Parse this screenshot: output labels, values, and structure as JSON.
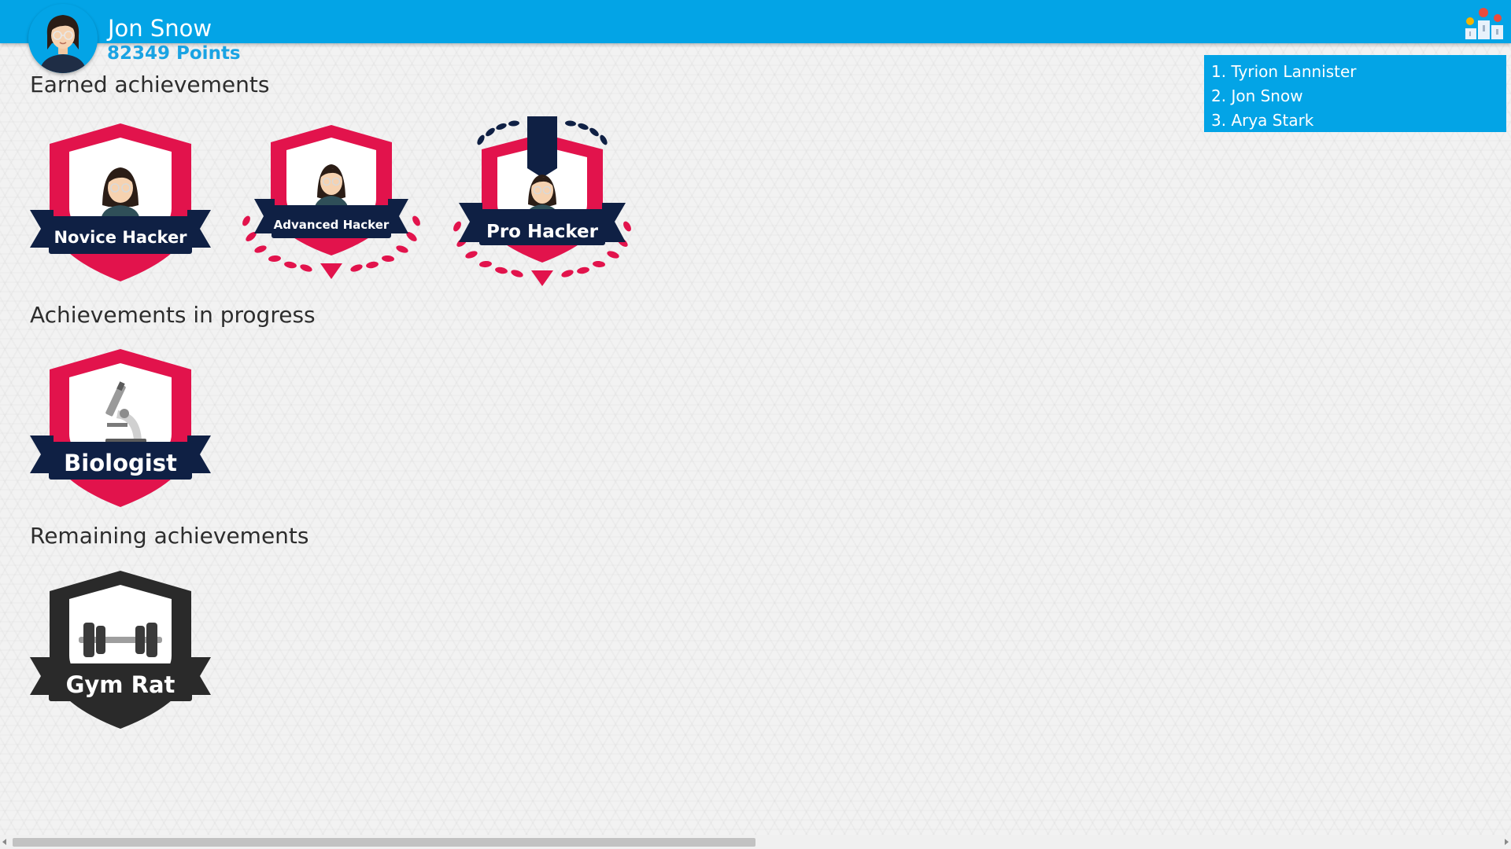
{
  "user": {
    "name": "Jon Snow",
    "points": "82349 Points"
  },
  "leaderboard": [
    "1. Tyrion Lannister",
    "2. Jon Snow",
    "3. Arya Stark"
  ],
  "sections": {
    "earned": "Earned achievements",
    "in_progress": "Achievements in progress",
    "remaining": "Remaining achievements"
  },
  "badges": {
    "novice": "Novice Hacker",
    "advanced": "Advanced Hacker",
    "pro": "Pro Hacker",
    "biologist": "Biologist",
    "gym": "Gym Rat"
  },
  "icons": {
    "avatar": "user-avatar",
    "leaderboard": "podium-icon",
    "hacker": "hacker-person-icon",
    "microscope": "microscope-icon",
    "dumbbell": "dumbbell-icon",
    "laurel": "laurel-wreath-icon"
  },
  "colors": {
    "header": "#03a4e6",
    "badge_red": "#e2134c",
    "badge_navy": "#0f2044",
    "badge_dark": "#2a2a2a",
    "points_text": "#1aa3e3"
  }
}
